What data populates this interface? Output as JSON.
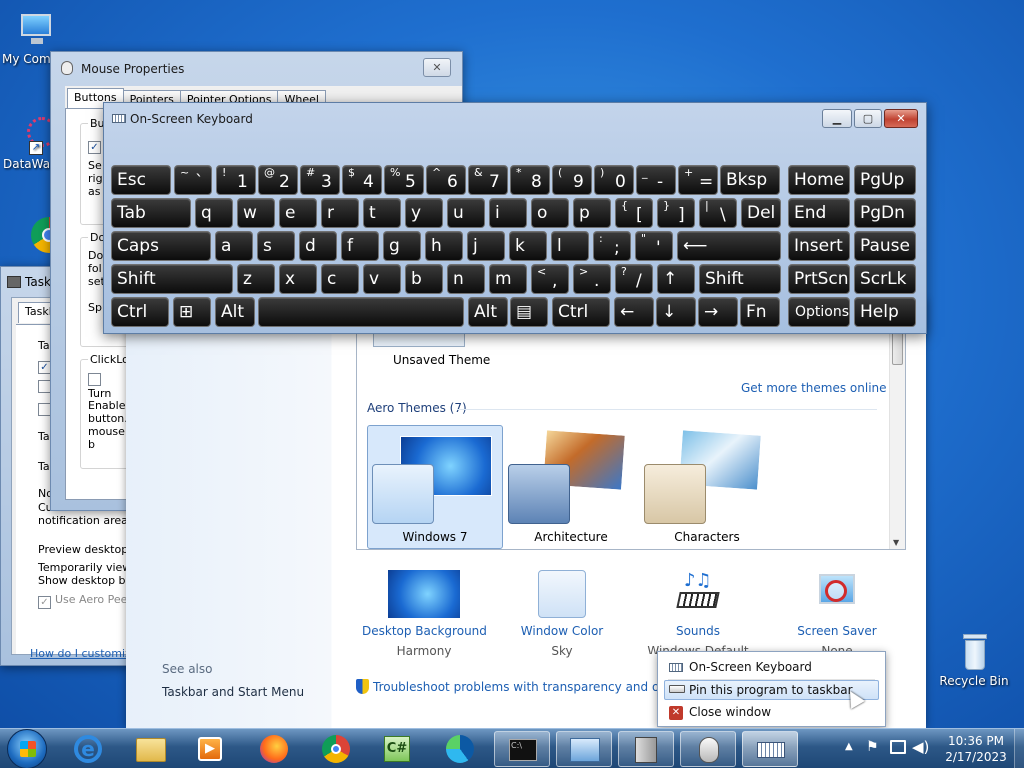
{
  "desktop": {
    "icons": [
      {
        "label": "My Computer",
        "visible": "My Comp"
      },
      {
        "label": "DataWagon",
        "visible": "DataWag"
      },
      {
        "label": "Recycle Bin"
      }
    ]
  },
  "mouse_props": {
    "title": "Mouse Properties",
    "tabs": [
      "Buttons",
      "Pointers",
      "Pointer Options",
      "Wheel"
    ],
    "button_cfg_trunc": "Bu",
    "sec1_lines": [
      "Se",
      "rig",
      "as"
    ],
    "dbl_trunc": "Do",
    "dbl_lines": [
      "Do",
      "fol",
      "set"
    ],
    "speed_trunc": "Sp",
    "clicklock_trunc": "ClickLoc",
    "turn_trunc": "Turn",
    "enable_lines": [
      "Enables",
      "button.",
      "mouse b"
    ]
  },
  "taskbar_props": {
    "title_trunc": "Task",
    "tab_trunc": "Taskb",
    "rows": [
      "Ta",
      "Ta",
      "Ta"
    ],
    "notif_head": "No",
    "notif_text": [
      "Customize which ic",
      "notification area."
    ],
    "peek_head": "Preview desktop w",
    "peek_text": [
      "Temporarily view t",
      "Show desktop butt"
    ],
    "use_peek": "Use Aero Peek",
    "help_link": "How do I customize"
  },
  "personalization": {
    "unsaved_theme": "Unsaved Theme",
    "get_more": "Get more themes online",
    "aero_header": "Aero Themes (7)",
    "themes": [
      {
        "name": "Windows 7"
      },
      {
        "name": "Architecture"
      },
      {
        "name": "Characters"
      }
    ],
    "bottom": [
      {
        "label": "Desktop Background",
        "sub": "Harmony"
      },
      {
        "label": "Window Color",
        "sub": "Sky"
      },
      {
        "label": "Sounds",
        "sub": "Windows Default"
      },
      {
        "label": "Screen Saver",
        "sub": "None"
      }
    ],
    "see_also": "See also",
    "taskbar_start": "Taskbar and Start Menu",
    "troubleshoot": "Troubleshoot problems with transparency and other"
  },
  "osk": {
    "title": "On-Screen Keyboard",
    "rows": [
      [
        {
          "m": "Esc"
        },
        {
          "u": "~",
          "l": "`"
        },
        {
          "u": "!",
          "l": "1"
        },
        {
          "u": "@",
          "l": "2"
        },
        {
          "u": "#",
          "l": "3"
        },
        {
          "u": "$",
          "l": "4"
        },
        {
          "u": "%",
          "l": "5"
        },
        {
          "u": "^",
          "l": "6"
        },
        {
          "u": "&",
          "l": "7"
        },
        {
          "u": "*",
          "l": "8"
        },
        {
          "u": "(",
          "l": "9"
        },
        {
          "u": ")",
          "l": "0"
        },
        {
          "u": "_",
          "l": "-"
        },
        {
          "u": "+",
          "l": "="
        },
        {
          "m": "Bksp"
        },
        {
          "m": "Home"
        },
        {
          "m": "PgUp"
        }
      ],
      [
        {
          "m": "Tab"
        },
        {
          "m": "q"
        },
        {
          "m": "w"
        },
        {
          "m": "e"
        },
        {
          "m": "r"
        },
        {
          "m": "t"
        },
        {
          "m": "y"
        },
        {
          "m": "u"
        },
        {
          "m": "i"
        },
        {
          "m": "o"
        },
        {
          "m": "p"
        },
        {
          "u": "{",
          "l": "["
        },
        {
          "u": "}",
          "l": "]"
        },
        {
          "u": "|",
          "l": "\\"
        },
        {
          "m": "Del"
        },
        {
          "m": "End"
        },
        {
          "m": "PgDn"
        }
      ],
      [
        {
          "m": "Caps"
        },
        {
          "m": "a"
        },
        {
          "m": "s"
        },
        {
          "m": "d"
        },
        {
          "m": "f"
        },
        {
          "m": "g"
        },
        {
          "m": "h"
        },
        {
          "m": "j"
        },
        {
          "m": "k"
        },
        {
          "m": "l"
        },
        {
          "u": ":",
          "l": ";"
        },
        {
          "u": "\"",
          "l": "'"
        },
        {
          "m": "⟵"
        },
        {
          "m": "Insert"
        },
        {
          "m": "Pause"
        }
      ],
      [
        {
          "m": "Shift"
        },
        {
          "m": "z"
        },
        {
          "m": "x"
        },
        {
          "m": "c"
        },
        {
          "m": "v"
        },
        {
          "m": "b"
        },
        {
          "m": "n"
        },
        {
          "m": "m"
        },
        {
          "u": "<",
          "l": ","
        },
        {
          "u": ">",
          "l": "."
        },
        {
          "u": "?",
          "l": "/"
        },
        {
          "m": "↑"
        },
        {
          "m": "Shift"
        },
        {
          "m": "PrtScn"
        },
        {
          "m": "ScrLk"
        }
      ],
      [
        {
          "m": "Ctrl"
        },
        {
          "m": "⊞"
        },
        {
          "m": "Alt"
        },
        {
          "m": ""
        },
        {
          "m": "Alt"
        },
        {
          "m": "▤"
        },
        {
          "m": "Ctrl"
        },
        {
          "m": "←"
        },
        {
          "m": "↓"
        },
        {
          "m": "→"
        },
        {
          "m": "Fn"
        },
        {
          "s": "Options"
        },
        {
          "m": "Help"
        }
      ]
    ]
  },
  "jumplist": {
    "items": [
      "On-Screen Keyboard",
      "Pin this program to taskbar",
      "Close window"
    ]
  },
  "taskbar": {
    "time": "10:36 PM",
    "date": "2/17/2023"
  }
}
